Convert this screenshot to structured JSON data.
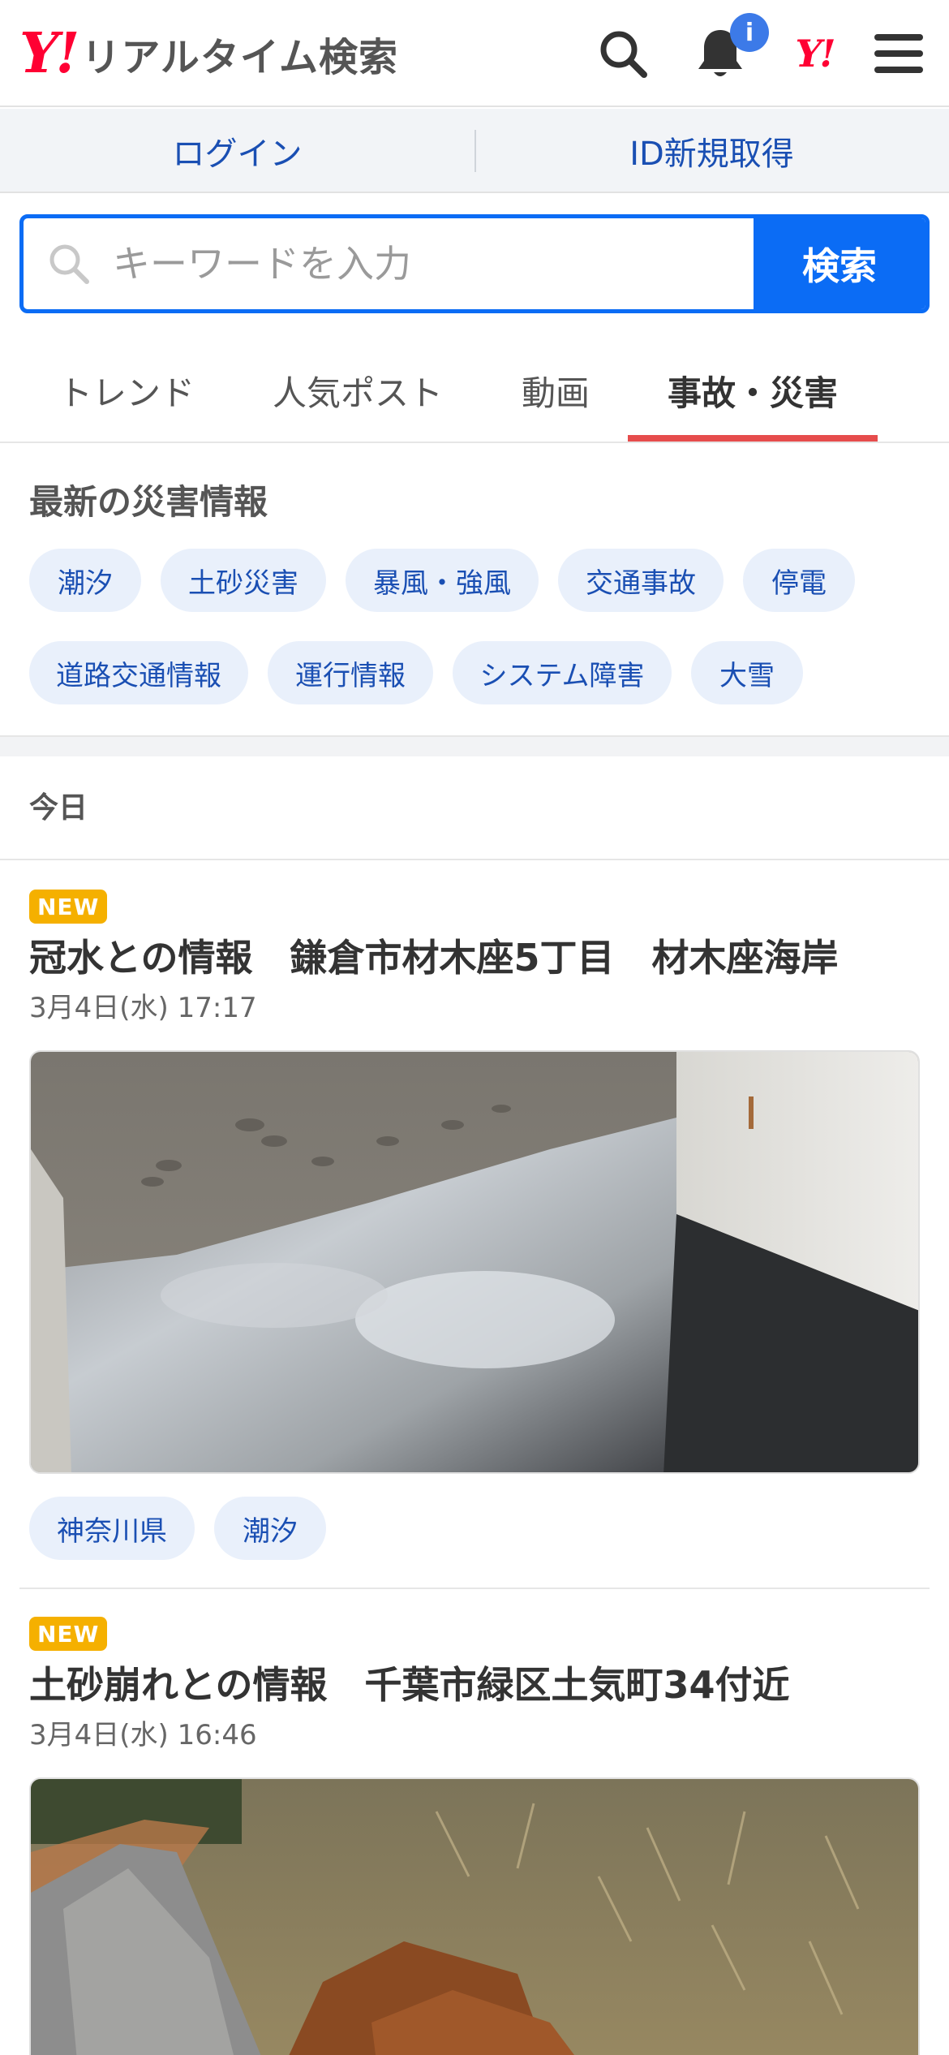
{
  "header": {
    "logo_mark": "Y!",
    "logo_text": "リアルタイム検索",
    "search_icon": "search-icon",
    "bell_icon": "bell-icon",
    "notification_badge": "i",
    "yj_mark": "Y!",
    "menu_icon": "hamburger-menu-icon"
  },
  "login_bar": {
    "login": "ログイン",
    "register": "ID新規取得"
  },
  "search": {
    "placeholder": "キーワードを入力",
    "button": "検索"
  },
  "tabs": [
    {
      "label": "トレンド",
      "active": false
    },
    {
      "label": "人気ポスト",
      "active": false
    },
    {
      "label": "動画",
      "active": false
    },
    {
      "label": "事故・災害",
      "active": true
    }
  ],
  "disaster": {
    "title": "最新の災害情報",
    "chips": [
      "潮汐",
      "土砂災害",
      "暴風・強風",
      "交通事故",
      "停電",
      "道路交通情報",
      "運行情報",
      "システム障害",
      "大雪"
    ]
  },
  "day_label": "今日",
  "posts": [
    {
      "badge": "NEW",
      "title": "冠水との情報　鎌倉市材木座5丁目　材木座海岸",
      "time": "3月4日(水) 17:17",
      "tags": [
        "神奈川県",
        "潮汐"
      ]
    },
    {
      "badge": "NEW",
      "title": "土砂崩れとの情報　千葉市緑区土気町34付近",
      "time": "3月4日(水) 16:46",
      "tags": []
    }
  ],
  "colors": {
    "yahoo_red": "#ff0033",
    "primary_blue": "#0b6cf5",
    "link_blue": "#1a4fb3",
    "chip_bg": "#e9f0fb",
    "tab_active_underline": "#e64c4c",
    "new_badge": "#f5b000"
  }
}
